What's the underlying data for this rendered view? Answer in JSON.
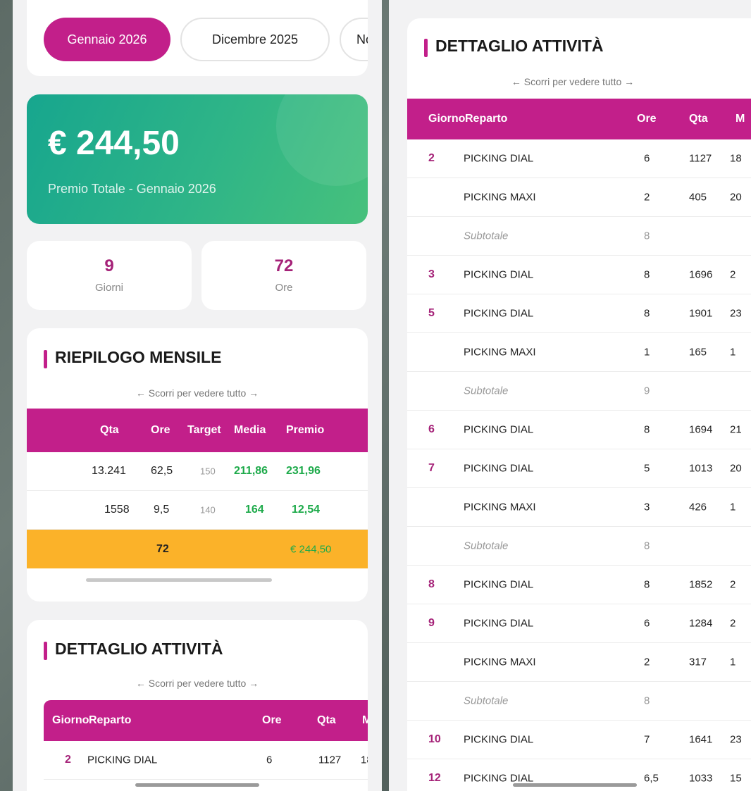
{
  "months": [
    "Gennaio 2026",
    "Dicembre 2025",
    "Nov"
  ],
  "total": {
    "amount": "€ 244,50",
    "subtitle": "Premio Totale - Gennaio 2026"
  },
  "stats": [
    {
      "value": "9",
      "label": "Giorni"
    },
    {
      "value": "72",
      "label": "Ore"
    }
  ],
  "summary": {
    "title": "RIEPILOGO MENSILE",
    "scroll_hint": "← Scorri per vedere tutto →",
    "headers": [
      "Qta",
      "Ore",
      "Target",
      "Media",
      "Premio"
    ],
    "rows": [
      {
        "qta": "13.241",
        "ore": "62,5",
        "target": "150",
        "media": "211,86",
        "premio": "231,96"
      },
      {
        "qta": "1558",
        "ore": "9,5",
        "target": "140",
        "media": "164",
        "premio": "12,54"
      }
    ],
    "total": {
      "ore": "72",
      "premio": "€ 244,50"
    }
  },
  "detail": {
    "title": "DETTAGLIO ATTIVITÀ",
    "scroll_hint": "← Scorri per vedere tutto →",
    "headers": {
      "giorno": "Giorno",
      "reparto": "Reparto",
      "ore": "Ore",
      "qta": "Qta",
      "m": "M"
    },
    "rows": [
      {
        "giorno": "2",
        "reparto": "PICKING DIAL",
        "ore": "6",
        "qta": "1127",
        "m": "18"
      },
      {
        "giorno": "",
        "reparto": "PICKING MAXI",
        "ore": "2",
        "qta": "405",
        "m": "20"
      },
      {
        "giorno": "",
        "reparto": "Subtotale",
        "ore": "8",
        "qta": "",
        "m": "",
        "subtotal": true
      },
      {
        "giorno": "3",
        "reparto": "PICKING DIAL",
        "ore": "8",
        "qta": "1696",
        "m": "2"
      },
      {
        "giorno": "5",
        "reparto": "PICKING DIAL",
        "ore": "8",
        "qta": "1901",
        "m": "23"
      },
      {
        "giorno": "",
        "reparto": "PICKING MAXI",
        "ore": "1",
        "qta": "165",
        "m": "1"
      },
      {
        "giorno": "",
        "reparto": "Subtotale",
        "ore": "9",
        "qta": "",
        "m": "",
        "subtotal": true
      },
      {
        "giorno": "6",
        "reparto": "PICKING DIAL",
        "ore": "8",
        "qta": "1694",
        "m": "21"
      },
      {
        "giorno": "7",
        "reparto": "PICKING DIAL",
        "ore": "5",
        "qta": "1013",
        "m": "20"
      },
      {
        "giorno": "",
        "reparto": "PICKING MAXI",
        "ore": "3",
        "qta": "426",
        "m": "1"
      },
      {
        "giorno": "",
        "reparto": "Subtotale",
        "ore": "8",
        "qta": "",
        "m": "",
        "subtotal": true
      },
      {
        "giorno": "8",
        "reparto": "PICKING DIAL",
        "ore": "8",
        "qta": "1852",
        "m": "2"
      },
      {
        "giorno": "9",
        "reparto": "PICKING DIAL",
        "ore": "6",
        "qta": "1284",
        "m": "2"
      },
      {
        "giorno": "",
        "reparto": "PICKING MAXI",
        "ore": "2",
        "qta": "317",
        "m": "1"
      },
      {
        "giorno": "",
        "reparto": "Subtotale",
        "ore": "8",
        "qta": "",
        "m": "",
        "subtotal": true
      },
      {
        "giorno": "10",
        "reparto": "PICKING DIAL",
        "ore": "7",
        "qta": "1641",
        "m": "23"
      },
      {
        "giorno": "12",
        "reparto": "PICKING DIAL",
        "ore": "6,5",
        "qta": "1033",
        "m": "15"
      }
    ]
  },
  "colors": {
    "accent": "#c21f8a",
    "green": "#1daa4a",
    "total_row": "#fbb229",
    "card_gradient_start": "#17a68e",
    "card_gradient_end": "#47c17c"
  }
}
